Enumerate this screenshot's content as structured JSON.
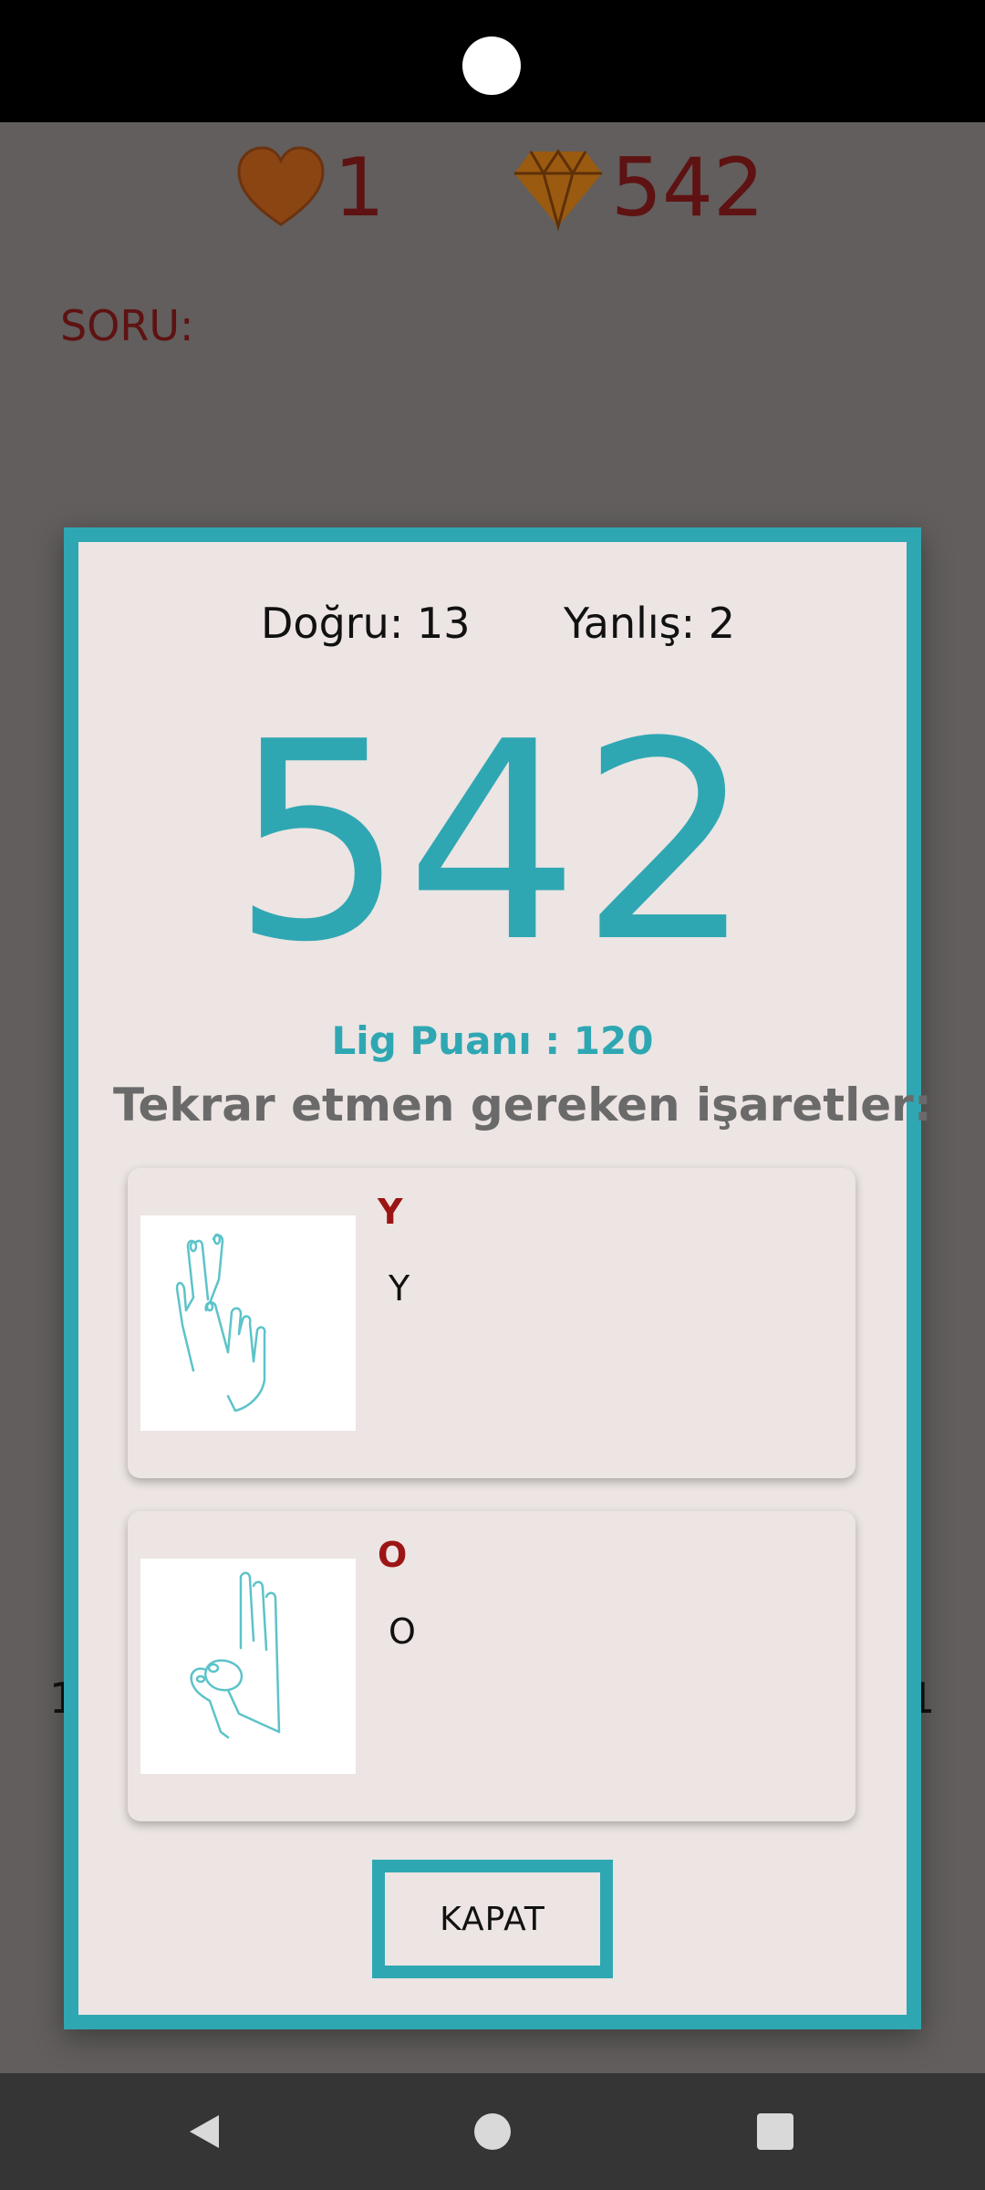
{
  "header": {
    "lives_value": "1",
    "gems_value": "542",
    "lives_icon": "heart-icon",
    "gems_icon": "diamond-icon"
  },
  "question": {
    "label": "SORU:"
  },
  "background": {
    "left_fragment": "1",
    "right_fragment": "1"
  },
  "result_dialog": {
    "correct_label": "Doğru: 13",
    "wrong_label": "Yanlış: 2",
    "score": "542",
    "league_points_label": "Lig Puanı : 120",
    "review_title": "Tekrar etmen gereken işaretler:",
    "signs": [
      {
        "title": "Y",
        "description": "Y",
        "image": "sign-y-hand"
      },
      {
        "title": "O",
        "description": "O",
        "image": "sign-o-hand"
      }
    ],
    "close_label": "KAPAT"
  },
  "colors": {
    "accent": "#2fa7b3",
    "dark_red": "#5e1212",
    "title_red": "#9c1515",
    "dialog_bg": "#ece5e3",
    "dim_bg": "#615e5d"
  }
}
